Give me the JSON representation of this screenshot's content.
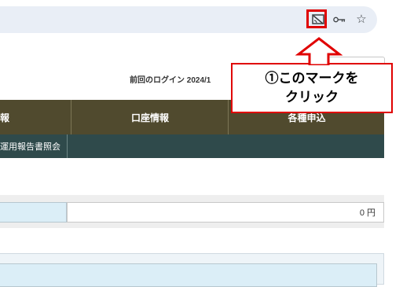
{
  "browser": {
    "icons": [
      "cast-off-icon",
      "key-icon",
      "star-icon"
    ],
    "star_glyph": "☆"
  },
  "page": {
    "last_login": "前回のログイン 2024/1",
    "nav_tabs": [
      "報",
      "口座情報",
      "各種申込"
    ],
    "sub_nav": [
      "運用報告書照会"
    ],
    "amount": "0 円"
  },
  "annotation": {
    "line1": "①このマークを",
    "line2": "クリック"
  },
  "colors": {
    "accent_red": "#e00000",
    "nav_main": "#504a2e",
    "nav_sub": "#2f4a4b"
  }
}
